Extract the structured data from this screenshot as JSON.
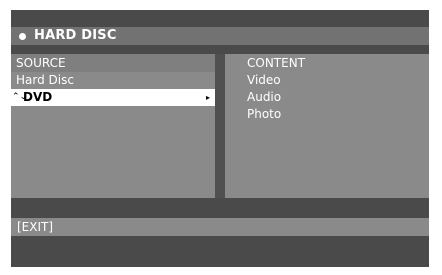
{
  "menu": {
    "title": "HARD DISC",
    "source_header": "SOURCE",
    "sources": [
      {
        "label": "Hard Disc",
        "selected": false
      },
      {
        "label": "DVD",
        "selected": true
      }
    ],
    "content_header": "CONTENT",
    "contents": [
      "Video",
      "Audio",
      "Photo"
    ],
    "exit_label": "[EXIT]"
  },
  "colors": {
    "background": "#4a4a4a",
    "title_bar": "#727272",
    "panel": "#8a8a8a",
    "highlight": "#ffffff",
    "text": "#ffffff",
    "highlight_text": "#000000"
  },
  "icons": {
    "title_bullet": "bullet-icon",
    "scroll_indicator": "scroll-indicator-icon",
    "submenu_arrow": "chevron-right-icon"
  }
}
